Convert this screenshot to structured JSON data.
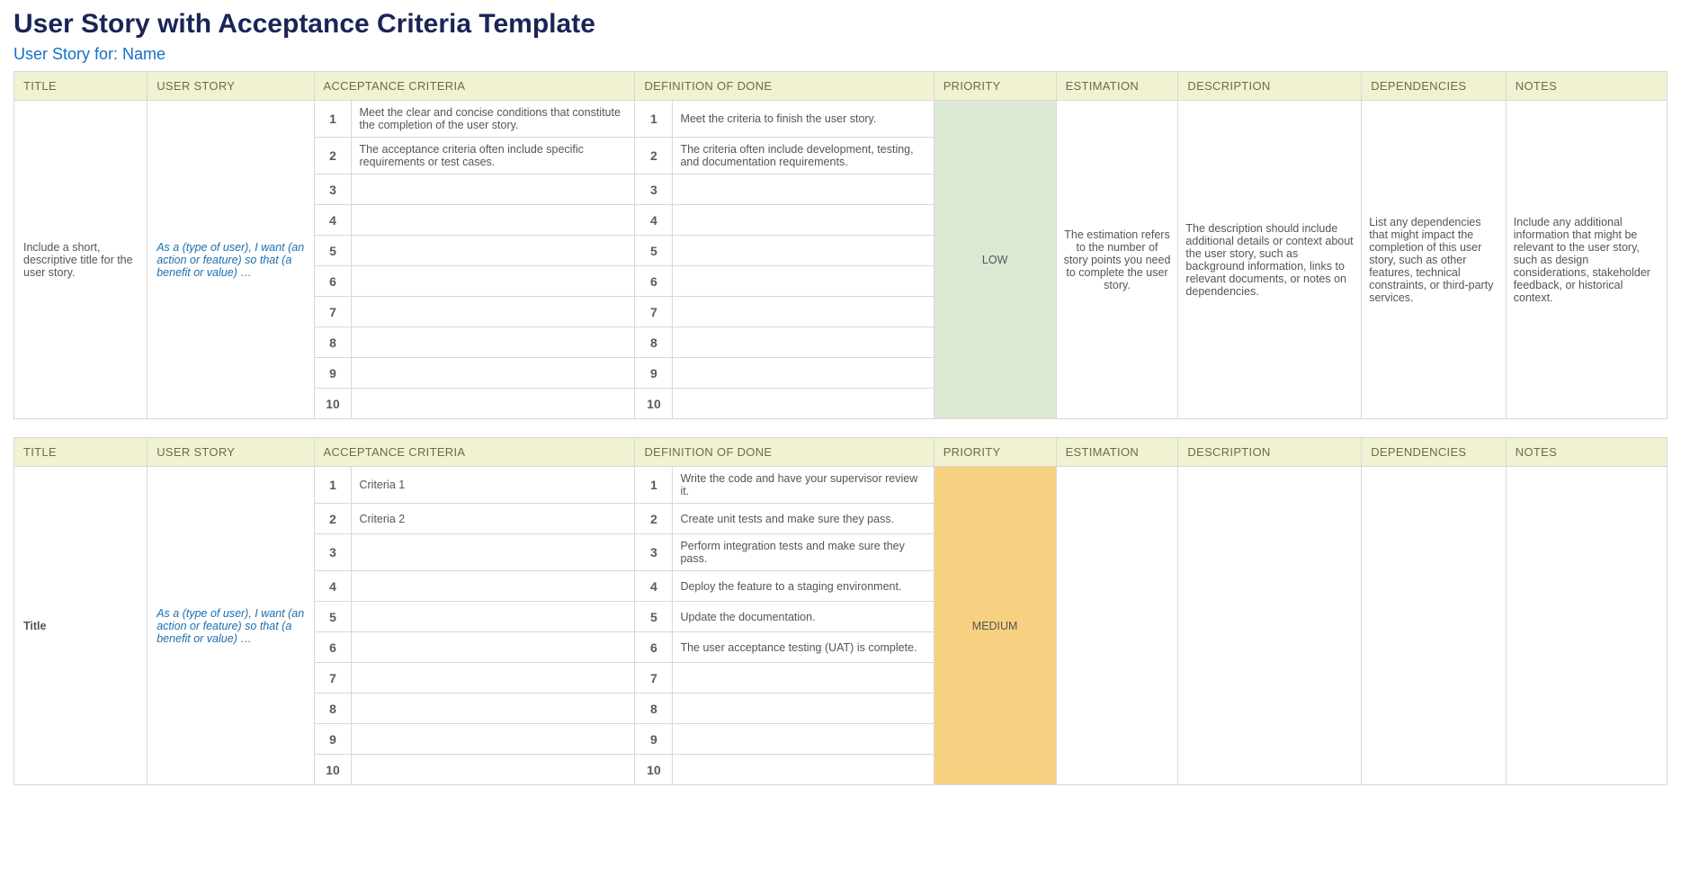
{
  "page": {
    "title": "User Story with Acceptance Criteria Template",
    "subtitle": "User Story for: Name"
  },
  "headers": {
    "title": "TITLE",
    "user_story": "USER STORY",
    "acceptance_criteria": "ACCEPTANCE CRITERIA",
    "definition_of_done": "DEFINITION OF DONE",
    "priority": "PRIORITY",
    "estimation": "ESTIMATION",
    "description": "DESCRIPTION",
    "dependencies": "DEPENDENCIES",
    "notes": "NOTES"
  },
  "stories": [
    {
      "title": "Include a short, descriptive title for the user story.",
      "title_bold": false,
      "user_story": "As a (type of user), I want (an action or feature) so that (a benefit or value) …",
      "acceptance_criteria": [
        "Meet the clear and concise conditions that constitute the completion of the user story.",
        "The acceptance criteria often include specific requirements or test cases.",
        "",
        "",
        "",
        "",
        "",
        "",
        "",
        ""
      ],
      "definition_of_done": [
        "Meet the criteria to finish the user story.",
        "The criteria often include development, testing, and documentation requirements.",
        "",
        "",
        "",
        "",
        "",
        "",
        "",
        ""
      ],
      "priority": "LOW",
      "priority_class": "priority-low",
      "estimation": "The estimation refers to the number of story points you need to complete the user story.",
      "description": "The description should include additional details or context about the user story, such as background information, links to relevant documents, or notes on dependencies.",
      "dependencies": "List any dependencies that might impact the completion of this user story, such as other features, technical constraints, or third-party services.",
      "notes": "Include any additional information that might be relevant to the user story, such as design considerations, stakeholder feedback, or historical context."
    },
    {
      "title": "Title",
      "title_bold": true,
      "user_story": "As a (type of user), I want (an action or feature) so that (a benefit or value) …",
      "acceptance_criteria": [
        "Criteria 1",
        "Criteria 2",
        "",
        "",
        "",
        "",
        "",
        "",
        "",
        ""
      ],
      "definition_of_done": [
        "Write the code and have your supervisor review it.",
        "Create unit tests and make sure they pass.",
        "Perform integration tests and make sure they pass.",
        "Deploy the feature to a staging environment.",
        "Update the documentation.",
        "The user acceptance testing (UAT) is complete.",
        "",
        "",
        "",
        ""
      ],
      "priority": "MEDIUM",
      "priority_class": "priority-medium",
      "estimation": "",
      "description": "",
      "dependencies": "",
      "notes": ""
    }
  ]
}
